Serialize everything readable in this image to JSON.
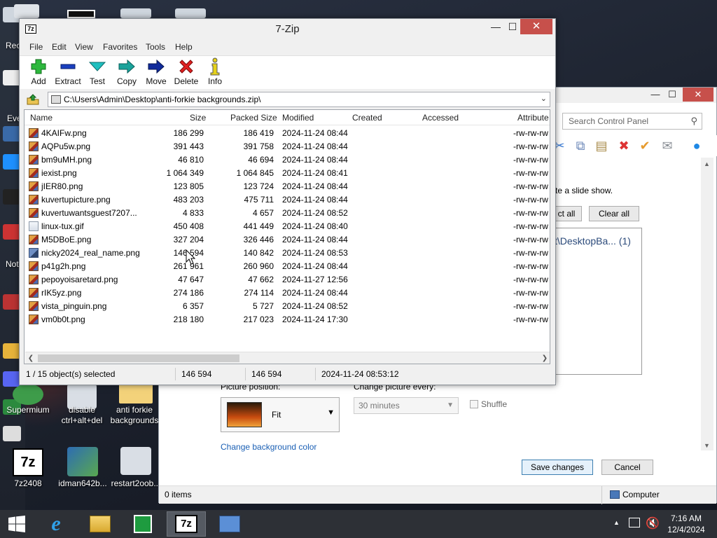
{
  "desktop": {
    "icons": [
      {
        "label": "7z2408"
      },
      {
        "label": "idman642b..."
      },
      {
        "label": "restart2oob..."
      },
      {
        "label": "disable\nctrl+alt+del"
      },
      {
        "label": "anti forkie\nbackgrounds"
      },
      {
        "label": "Supermium"
      }
    ],
    "left_strip_labels": [
      "Rec",
      "Eve",
      "Not"
    ]
  },
  "control_panel": {
    "search_placeholder": "Search Control Panel",
    "slide_show_text": "te a slide show.",
    "select_all_label": "ct all",
    "clear_all_label": "Clear all",
    "folder_item": "t\\DesktopBa... (1)",
    "picture_position_label": "Picture position:",
    "picture_position_value": "Fit",
    "change_every_label": "Change picture every:",
    "change_every_value": "30 minutes",
    "shuffle_label": "Shuffle",
    "bg_color_link": "Change background color",
    "save_label": "Save changes",
    "cancel_label": "Cancel",
    "status_items": "0 items",
    "status_computer": "Computer"
  },
  "zip": {
    "title": "7-Zip",
    "app_icon": "7z",
    "menu": [
      "File",
      "Edit",
      "View",
      "Favorites",
      "Tools",
      "Help"
    ],
    "toolbar": [
      {
        "label": "Add",
        "icon": "add-icon"
      },
      {
        "label": "Extract",
        "icon": "extract-icon"
      },
      {
        "label": "Test",
        "icon": "test-icon"
      },
      {
        "label": "Copy",
        "icon": "copy-icon"
      },
      {
        "label": "Move",
        "icon": "move-icon"
      },
      {
        "label": "Delete",
        "icon": "delete-icon"
      },
      {
        "label": "Info",
        "icon": "info-icon"
      }
    ],
    "path": "C:\\Users\\Admin\\Desktop\\anti-forkie backgrounds.zip\\",
    "columns": [
      "Name",
      "Size",
      "Packed Size",
      "Modified",
      "Created",
      "Accessed",
      "Attribute"
    ],
    "files": [
      {
        "name": "4KAIFw.png",
        "size": "186 299",
        "packed": "186 419",
        "modified": "2024-11-24 08:44",
        "attr": "-rw-rw-rw",
        "kind": "png"
      },
      {
        "name": "AQPu5w.png",
        "size": "391 443",
        "packed": "391 758",
        "modified": "2024-11-24 08:44",
        "attr": "-rw-rw-rw",
        "kind": "png"
      },
      {
        "name": "bm9uMH.png",
        "size": "46 810",
        "packed": "46 694",
        "modified": "2024-11-24 08:44",
        "attr": "-rw-rw-rw",
        "kind": "png"
      },
      {
        "name": "iexist.png",
        "size": "1 064 349",
        "packed": "1 064 845",
        "modified": "2024-11-24 08:41",
        "attr": "-rw-rw-rw",
        "kind": "png"
      },
      {
        "name": "jIER80.png",
        "size": "123 805",
        "packed": "123 724",
        "modified": "2024-11-24 08:44",
        "attr": "-rw-rw-rw",
        "kind": "png"
      },
      {
        "name": "kuvertupicture.png",
        "size": "483 203",
        "packed": "475 711",
        "modified": "2024-11-24 08:44",
        "attr": "-rw-rw-rw",
        "kind": "png"
      },
      {
        "name": "kuvertuwantsguest7207...",
        "size": "4 833",
        "packed": "4 657",
        "modified": "2024-11-24 08:52",
        "attr": "-rw-rw-rw",
        "kind": "png"
      },
      {
        "name": "linux-tux.gif",
        "size": "450 408",
        "packed": "441 449",
        "modified": "2024-11-24 08:40",
        "attr": "-rw-rw-rw",
        "kind": "gif"
      },
      {
        "name": "M5DBoE.png",
        "size": "327 204",
        "packed": "326 446",
        "modified": "2024-11-24 08:44",
        "attr": "-rw-rw-rw",
        "kind": "png"
      },
      {
        "name": "nicky2024_real_name.png",
        "size": "146 594",
        "packed": "140 842",
        "modified": "2024-11-24 08:53",
        "attr": "-rw-rw-rw",
        "kind": "blue"
      },
      {
        "name": "p41g2h.png",
        "size": "261 961",
        "packed": "260 960",
        "modified": "2024-11-24 08:44",
        "attr": "-rw-rw-rw",
        "kind": "png"
      },
      {
        "name": "pepoyoisaretard.png",
        "size": "47 647",
        "packed": "47 662",
        "modified": "2024-11-27 12:56",
        "attr": "-rw-rw-rw",
        "kind": "png"
      },
      {
        "name": "rIK5yz.png",
        "size": "274 186",
        "packed": "274 114",
        "modified": "2024-11-24 08:44",
        "attr": "-rw-rw-rw",
        "kind": "png"
      },
      {
        "name": "vista_pinguin.png",
        "size": "6 357",
        "packed": "5 727",
        "modified": "2024-11-24 08:52",
        "attr": "-rw-rw-rw",
        "kind": "png"
      },
      {
        "name": "vm0b0t.png",
        "size": "218 180",
        "packed": "217 023",
        "modified": "2024-11-24 17:30",
        "attr": "-rw-rw-rw",
        "kind": "png"
      }
    ],
    "status": {
      "selection": "1 / 15 object(s) selected",
      "size": "146 594",
      "packed": "146 594",
      "modified": "2024-11-24 08:53:12"
    }
  },
  "taskbar": {
    "apps": [
      "start-icon",
      "ie-icon",
      "explorer-icon",
      "store-icon",
      "7zip-icon",
      "control-panel-icon"
    ],
    "time": "7:16 AM",
    "date": "12/4/2024"
  }
}
